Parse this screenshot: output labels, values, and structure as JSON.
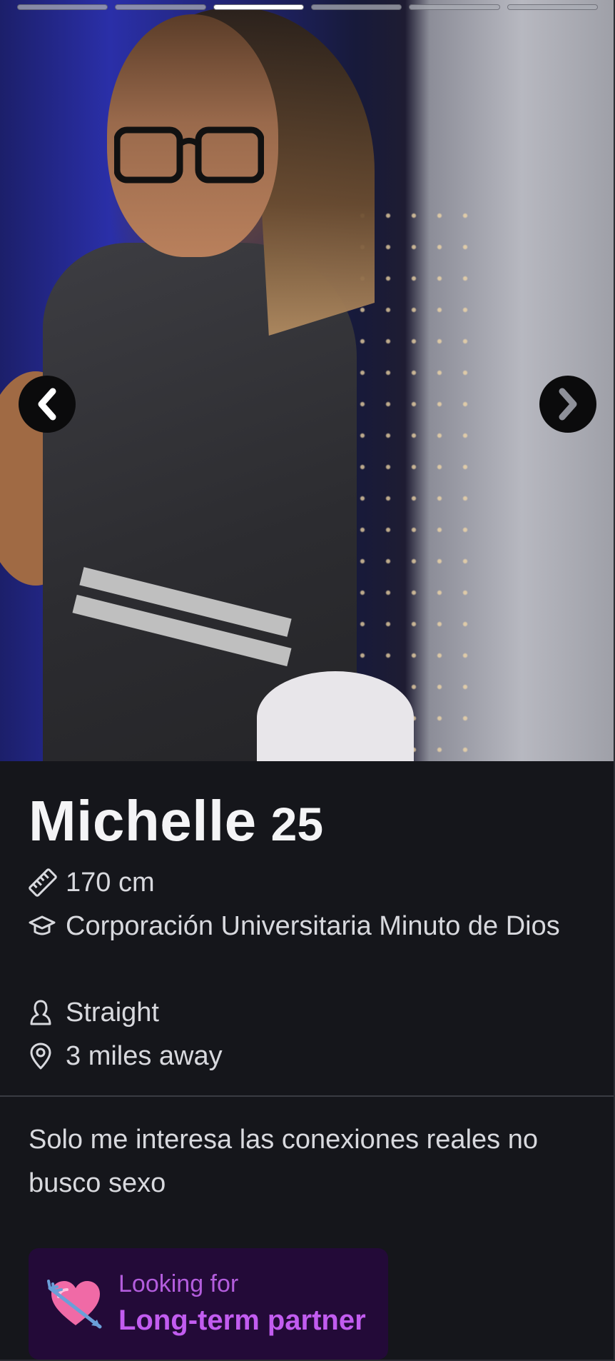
{
  "photos": {
    "count": 6,
    "active_index": 2
  },
  "profile": {
    "name": "Michelle",
    "age": "25",
    "height": "170 cm",
    "education": "Corporación Universitaria Minuto de Dios",
    "orientation": "Straight",
    "distance": "3 miles away"
  },
  "bio": "Solo me interesa las conexiones reales no busco sexo",
  "looking_for": {
    "label": "Looking for",
    "value": "Long-term partner"
  },
  "colors": {
    "background": "#15161b",
    "text": "#d8d9de",
    "accent": "#c25cf0",
    "badge_bg": "#230a38"
  },
  "icons": {
    "height": "ruler-icon",
    "education": "graduation-cap-icon",
    "orientation": "person-icon",
    "distance": "location-pin-icon",
    "prev": "chevron-left-icon",
    "next": "chevron-right-icon",
    "looking_for": "heart-arrow-emoji"
  }
}
